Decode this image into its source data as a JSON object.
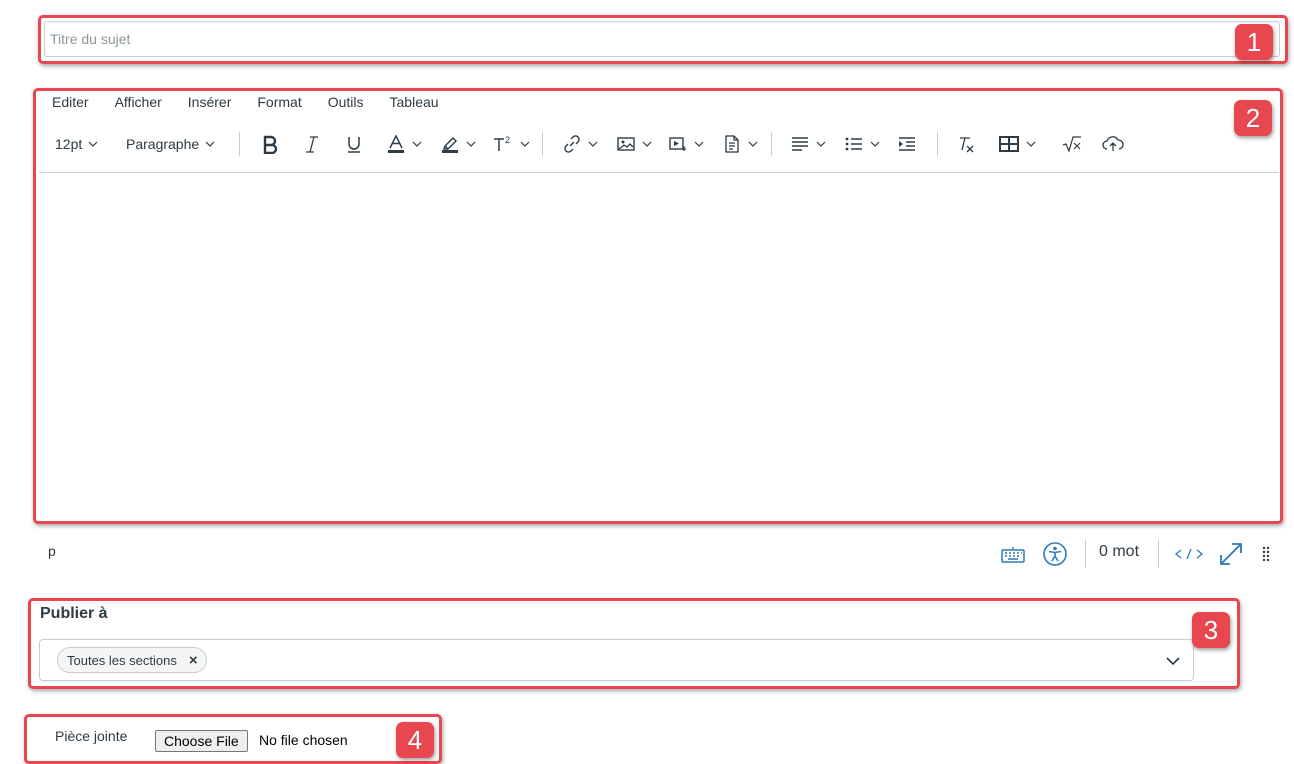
{
  "title_field": {
    "value": "",
    "placeholder": "Titre du sujet"
  },
  "editor": {
    "menu": [
      "Editer",
      "Afficher",
      "Insérer",
      "Format",
      "Outils",
      "Tableau"
    ],
    "toolbar": {
      "font_size": "12pt",
      "block_format": "Paragraphe"
    },
    "status": {
      "element_path": "p",
      "word_count": "0 mot"
    }
  },
  "publish": {
    "label": "Publier à",
    "chip": "Toutes les sections",
    "chip_remove": "×"
  },
  "attachment": {
    "label": "Pièce jointe",
    "button": "Choose File",
    "status": "No file chosen"
  },
  "badges": [
    "1",
    "2",
    "3",
    "4"
  ],
  "colors": {
    "highlight": "#e8474f",
    "icon_blue": "#2b7abc",
    "text": "#2d3b45",
    "border": "#c7cdd1"
  }
}
